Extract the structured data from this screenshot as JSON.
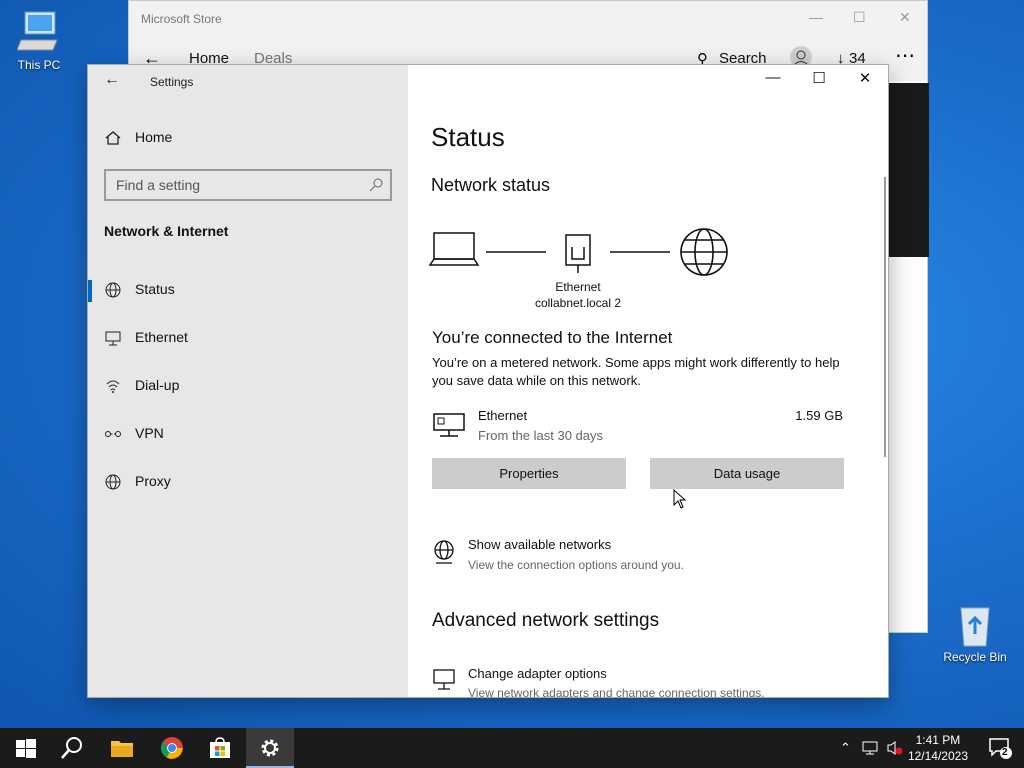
{
  "desktop": {
    "icons": {
      "this_pc": "This PC",
      "recycle_bin": "Recycle Bin"
    }
  },
  "store": {
    "title": "Microsoft Store",
    "nav": {
      "home": "Home",
      "deals": "Deals",
      "search": "Search",
      "downloads": "34"
    }
  },
  "settings": {
    "app_title": "Settings",
    "home": "Home",
    "search_placeholder": "Find a setting",
    "section": "Network & Internet",
    "nav": [
      {
        "label": "Status",
        "icon": "status-globe-icon"
      },
      {
        "label": "Ethernet",
        "icon": "ethernet-icon"
      },
      {
        "label": "Dial-up",
        "icon": "dialup-icon"
      },
      {
        "label": "VPN",
        "icon": "vpn-icon"
      },
      {
        "label": "Proxy",
        "icon": "proxy-globe-icon"
      }
    ],
    "page_title": "Status",
    "network_status": "Network status",
    "diagram": {
      "adapter_name": "Ethernet",
      "network_name": "collabnet.local 2"
    },
    "connected_title": "You’re connected to the Internet",
    "connected_desc": "You’re on a metered network. Some apps might work differently to help you save data while on this network.",
    "connection": {
      "name": "Ethernet",
      "period": "From the last 30 days",
      "usage": "1.59 GB"
    },
    "buttons": {
      "properties": "Properties",
      "data_usage": "Data usage"
    },
    "show_networks": {
      "title": "Show available networks",
      "subtitle": "View the connection options around you."
    },
    "advanced_title": "Advanced network settings",
    "change_adapter": {
      "title": "Change adapter options",
      "subtitle": "View network adapters and change connection settings."
    }
  },
  "taskbar": {
    "time": "1:41 PM",
    "date": "12/14/2023",
    "notifications": "2"
  },
  "colors": {
    "accent": "#0067c0",
    "sidebar": "#e7e7e7",
    "taskbar": "#1b1b1b",
    "button": "#cccccc"
  }
}
